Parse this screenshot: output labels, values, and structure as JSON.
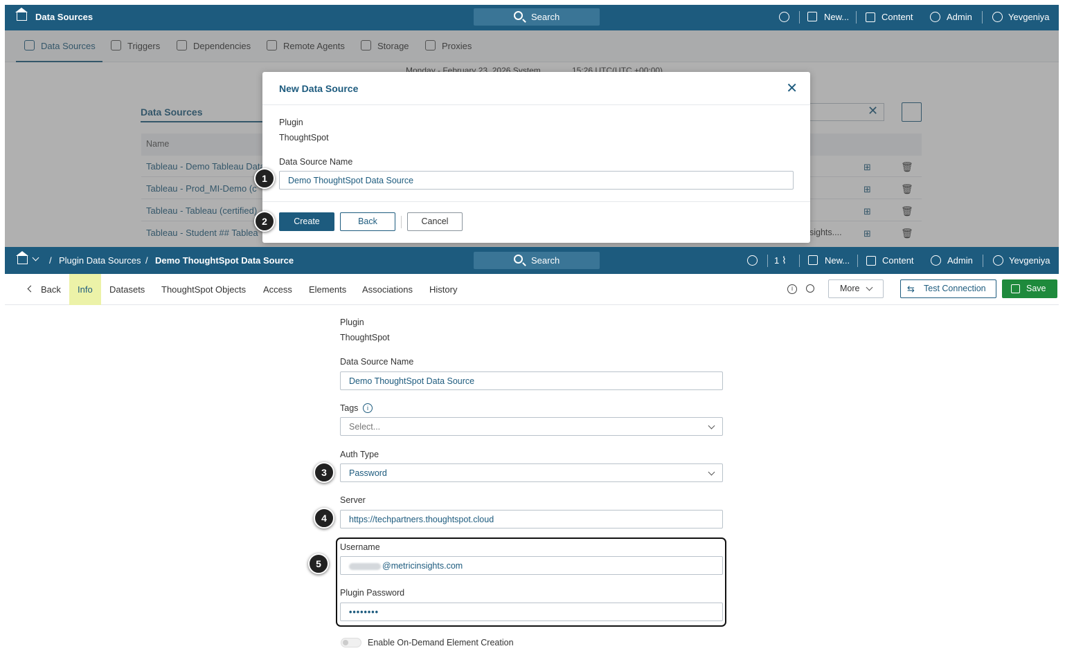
{
  "top_window": {
    "title": "Data Sources",
    "search_label": "Search",
    "nav": {
      "new": "New...",
      "content": "Content",
      "admin": "Admin",
      "user": "Yevgeniya"
    },
    "subnav": [
      "Data Sources",
      "Triggers",
      "Dependencies",
      "Remote Agents",
      "Storage",
      "Proxies"
    ],
    "date_line": "Monday - February 23, 2026 System",
    "time_line": "15:26 UTC(UTC +00:00)",
    "bg_heading": "Data Sources",
    "bg_col_name": "Name",
    "bg_rows": [
      "Tableau - Demo Tableau Data",
      "Tableau - Prod_MI-Demo (c",
      "Tableau - Tableau (certified)",
      "Tableau - Student ## Tablea"
    ],
    "bg_row_tail": "sights...."
  },
  "modal": {
    "title": "New Data Source",
    "plugin_label": "Plugin",
    "plugin_value": "ThoughtSpot",
    "name_label": "Data Source Name",
    "name_value": "Demo ThoughtSpot Data Source",
    "create": "Create",
    "back": "Back",
    "cancel": "Cancel"
  },
  "callouts": [
    "1",
    "2",
    "3",
    "4",
    "5"
  ],
  "bottom_window": {
    "breadcrumb_1": "Plugin Data Sources",
    "breadcrumb_sep": "/",
    "breadcrumb_2": "Demo ThoughtSpot Data Source",
    "search_label": "Search",
    "notif_count": "1",
    "nav": {
      "new": "New...",
      "content": "Content",
      "admin": "Admin",
      "user": "Yevgeniya"
    },
    "back": "Back",
    "tabs": [
      "Info",
      "Datasets",
      "ThoughtSpot Objects",
      "Access",
      "Elements",
      "Associations",
      "History"
    ],
    "more": "More",
    "test_connection": "Test Connection",
    "save": "Save",
    "form": {
      "plugin_label": "Plugin",
      "plugin_value": "ThoughtSpot",
      "name_label": "Data Source Name",
      "name_value": "Demo ThoughtSpot Data Source",
      "tags_label": "Tags",
      "tags_placeholder": "Select...",
      "auth_label": "Auth Type",
      "auth_value": "Password",
      "server_label": "Server",
      "server_value": "https://techpartners.thoughtspot.cloud",
      "username_label": "Username",
      "username_value": "@metricinsights.com",
      "password_label": "Plugin Password",
      "password_value": "••••••••",
      "toggle_label": "Enable On-Demand Element Creation"
    }
  },
  "colors": {
    "brand": "#1d5b7e",
    "save_green": "#1e8a3c",
    "tab_highlight": "#ecf2a8"
  }
}
